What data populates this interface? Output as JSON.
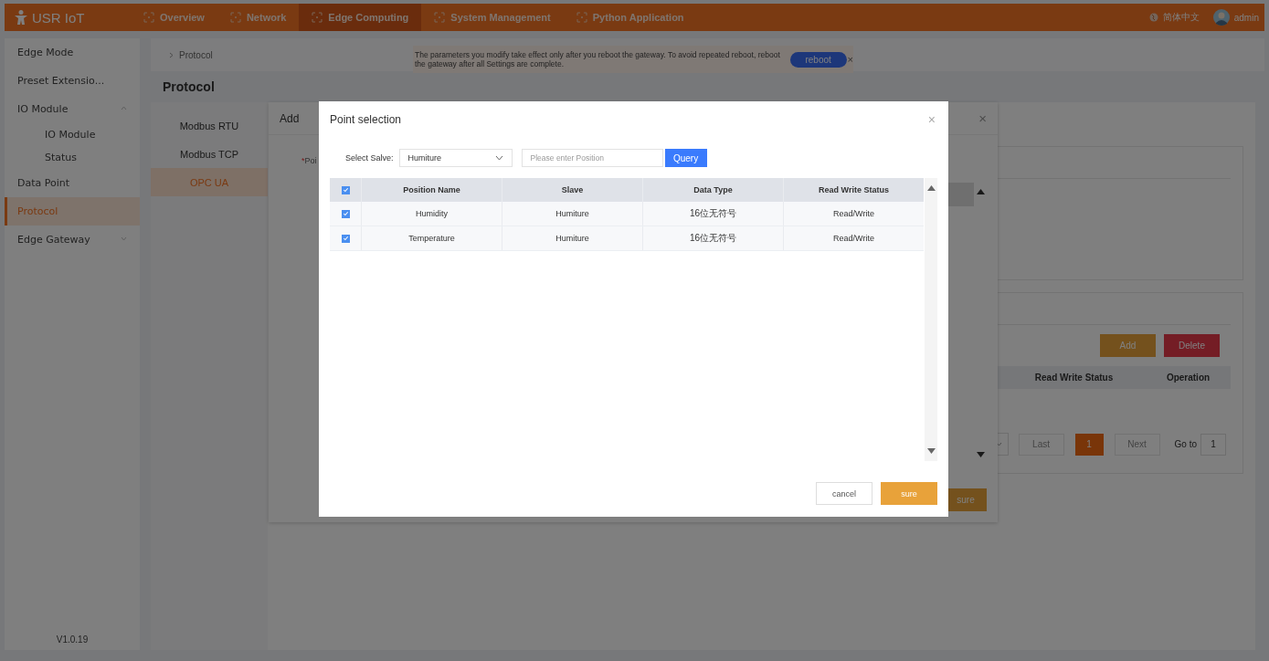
{
  "header": {
    "logo": "USR IoT",
    "nav": [
      {
        "label": "Overview",
        "selected": false
      },
      {
        "label": "Network",
        "selected": false
      },
      {
        "label": "Edge Computing",
        "selected": true
      },
      {
        "label": "System Management",
        "selected": false
      },
      {
        "label": "Python Application",
        "selected": false
      }
    ],
    "language": "简体中文",
    "user": "admin"
  },
  "sidebar": {
    "items": [
      {
        "label": "Edge Mode",
        "selected": false
      },
      {
        "label": "Preset Extensio...",
        "selected": false
      },
      {
        "label": "IO Module",
        "selected": false,
        "expanded": true,
        "children": [
          {
            "label": "IO Module",
            "selected": false
          },
          {
            "label": "Status",
            "selected": false
          }
        ]
      },
      {
        "label": "Data Point",
        "selected": false
      },
      {
        "label": "Protocol",
        "selected": true
      },
      {
        "label": "Edge Gateway",
        "selected": false,
        "expanded": false
      }
    ],
    "version": "V1.0.19"
  },
  "breadcrumb": "Protocol",
  "notice": {
    "text": "The parameters you modify take effect only after you reboot the gateway. To avoid repeated reboot, reboot the gateway after all Settings are complete.",
    "button": "reboot",
    "close": "×"
  },
  "page_title": "Protocol",
  "protocol_tabs": [
    {
      "label": "Modbus RTU",
      "selected": false
    },
    {
      "label": "Modbus TCP",
      "selected": false
    },
    {
      "label": "OPC UA",
      "selected": true
    }
  ],
  "config_panel": {
    "add_button": "Add",
    "delete_button": "Delete",
    "columns": [
      "Read Write Status",
      "Operation"
    ],
    "pagination": {
      "prev": "Last",
      "page": "1",
      "next": "Next",
      "goto_label": "Go to",
      "goto_value": "1"
    }
  },
  "add_dialog": {
    "title": "Add",
    "close": "×",
    "required_mark": "*",
    "field_label": "Poi",
    "confirm": "sure"
  },
  "point_dialog": {
    "title": "Point selection",
    "close": "×",
    "slave_label": "Select Salve:",
    "slave_value": "Humiture",
    "search_placeholder": "Please enter Position",
    "query": "Query",
    "select_all": true,
    "columns": [
      "Position Name",
      "Slave",
      "Data Type",
      "Read Write Status"
    ],
    "rows": [
      {
        "checked": true,
        "cells": [
          "Humidity",
          "Humiture",
          "16位无符号",
          "Read/Write"
        ]
      },
      {
        "checked": true,
        "cells": [
          "Temperature",
          "Humiture",
          "16位无符号",
          "Read/Write"
        ]
      }
    ],
    "cancel": "cancel",
    "confirm": "sure"
  }
}
